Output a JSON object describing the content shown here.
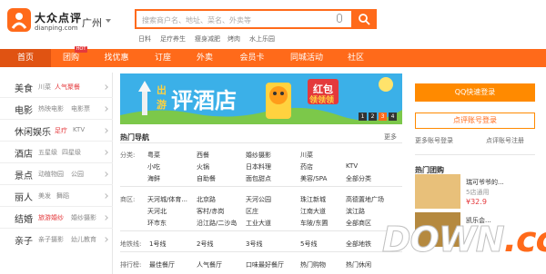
{
  "header": {
    "brand_cn": "大众点评",
    "brand_en": "dianping.com",
    "city": "广州",
    "search_placeholder": "搜索商户名、地址、菜名、外卖等",
    "hot_keywords": [
      "日料",
      "足疗养生",
      "瘦身减肥",
      "烤肉",
      "水上乐园"
    ]
  },
  "nav": {
    "items": [
      "首页",
      "团购",
      "找优惠",
      "订座",
      "外卖",
      "会员卡",
      "同城活动",
      "社区"
    ],
    "hot_badge": "HOT"
  },
  "sidebar": {
    "categories": [
      {
        "name": "美食",
        "subs": [
          "川菜",
          "人气聚餐"
        ]
      },
      {
        "name": "电影",
        "subs": [
          "热映电影",
          "电影票"
        ]
      },
      {
        "name": "休闲娱乐",
        "subs": [
          "足疗",
          "KTV"
        ]
      },
      {
        "name": "酒店",
        "subs": [
          "五星级",
          "四星级"
        ]
      },
      {
        "name": "景点",
        "subs": [
          "动植物园",
          "公园"
        ]
      },
      {
        "name": "丽人",
        "subs": [
          "美发",
          "舞蹈"
        ]
      },
      {
        "name": "结婚",
        "subs": [
          "旅游婚纱",
          "婚纱摄影"
        ]
      },
      {
        "name": "亲子",
        "subs": [
          "亲子摄影",
          "幼儿教育"
        ]
      }
    ]
  },
  "banner": {
    "text_left_top": "出",
    "text_left_bottom": "游",
    "text_main": "评酒店",
    "text_hongbao": "红包",
    "text_lingbu": "领领领",
    "slides": [
      "1",
      "2",
      "3",
      "4"
    ]
  },
  "hot_nav": {
    "title": "热门导航",
    "more": "更多",
    "rows": [
      {
        "label": "分类:",
        "cells": [
          "粤菜",
          "西餐",
          "婚纱摄影",
          "川菜",
          "小吃",
          "火锅",
          "日本料理",
          "药店",
          "KTV",
          "海鲜",
          "自助餐",
          "面包甜点",
          "美容/SPA",
          "全部分类"
        ]
      },
      {
        "label": "商区:",
        "cells": [
          "天河城/体育...",
          "北京路",
          "天河公园",
          "珠江新城",
          "高德置地广场",
          "天河北",
          "客村/赤岗",
          "区庄",
          "江南大道",
          "滨江路",
          "环市东",
          "沿江路/二沙岛",
          "工业大道",
          "车陂/东圃",
          "全部商区"
        ]
      },
      {
        "label": "地铁线:",
        "cells": [
          "1号线",
          "2号线",
          "3号线",
          "5号线",
          "全部地铁"
        ]
      },
      {
        "label": "排行榜:",
        "cells": [
          "最佳餐厅",
          "人气餐厅",
          "口味最好餐厅",
          "热门购物",
          "热门休闲"
        ]
      }
    ]
  },
  "right": {
    "qq_login": "QQ快速登录",
    "account_login": "点评账号登录",
    "more_login": "更多账号登录",
    "register": "点评账号注册",
    "hot_deals_title": "热门团购",
    "deals": [
      {
        "title": "瑞可爷爷的...",
        "subtitle": "5店通用",
        "price": "¥32.9"
      },
      {
        "title": "凯乐会..."
      }
    ]
  },
  "watermark": {
    "text": "DOWN",
    "suffix": ".cc"
  },
  "colors": {
    "brand": "#ff6a1a",
    "nav_active": "#e05312",
    "hot_red": "#e4393c",
    "login_orange": "#ff8a00"
  }
}
